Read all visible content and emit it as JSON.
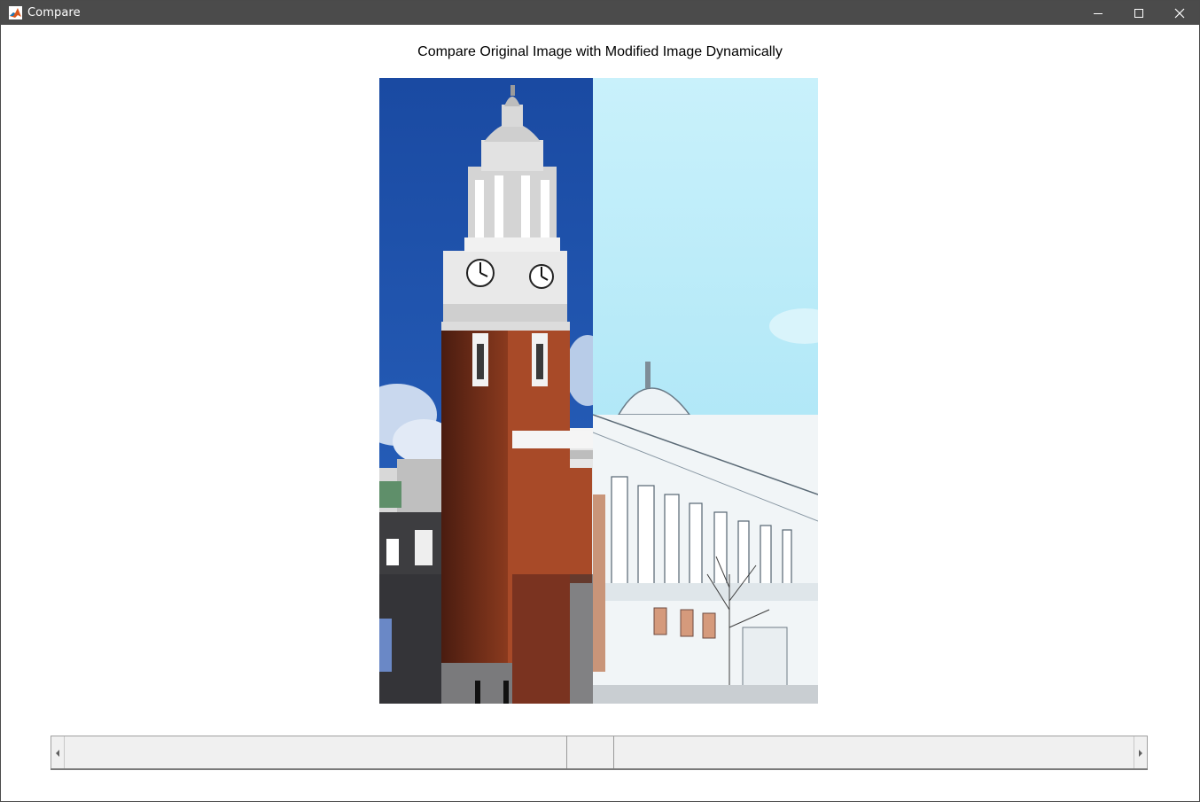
{
  "window": {
    "title": "Compare",
    "app_icon": "matlab-icon",
    "controls": [
      "minimize-icon",
      "maximize-icon",
      "close-icon"
    ]
  },
  "figure": {
    "title": "Compare Original Image with Modified Image Dynamically",
    "image_description_icon": "town-hall-clock-tower-photo",
    "split_fraction": 0.487
  },
  "slider": {
    "value_fraction": 0.491,
    "left_arrow_icon": "arrow-left-icon",
    "right_arrow_icon": "arrow-right-icon"
  },
  "colors": {
    "titlebar": "#4b4b4b",
    "sky_original": "#1c4fa8",
    "sky_modified": "#b7ebf8",
    "brick": "#a84a28"
  }
}
